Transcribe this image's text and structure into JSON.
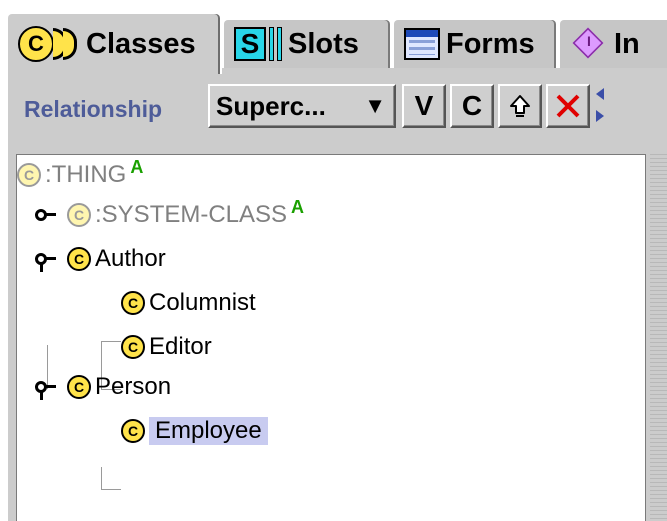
{
  "tabs": [
    {
      "label": "Classes",
      "icon": "classes-icon",
      "active": true
    },
    {
      "label": "Slots",
      "icon": "slots-icon",
      "active": false
    },
    {
      "label": "Forms",
      "icon": "forms-icon",
      "active": false
    },
    {
      "label": "In",
      "icon": "instances-icon",
      "active": false
    }
  ],
  "toolbar": {
    "relationship_label": "Relationship",
    "relationship_value": "Superc...",
    "view_label": "V",
    "create_label": "C",
    "delete_icon": "delete-icon",
    "move_up_icon": "move-up-icon"
  },
  "tree": {
    "root": {
      "label": ":THING",
      "badge": "A",
      "muted": true
    },
    "items": [
      {
        "label": ":SYSTEM-CLASS",
        "badge": "A",
        "muted": true,
        "expanded": false
      },
      {
        "label": "Author",
        "muted": false,
        "expanded": true,
        "children": [
          {
            "label": "Columnist"
          },
          {
            "label": "Editor"
          }
        ]
      },
      {
        "label": "Person",
        "muted": false,
        "expanded": true,
        "children": [
          {
            "label": "Employee",
            "selected": true
          }
        ]
      }
    ]
  },
  "colors": {
    "panel_bg": "#cccccc",
    "class_icon": "#ffe34a",
    "selection": "#c8cbf0",
    "badge": "#1aa000",
    "relationship_label": "#4e5c99",
    "delete": "#e00000"
  }
}
